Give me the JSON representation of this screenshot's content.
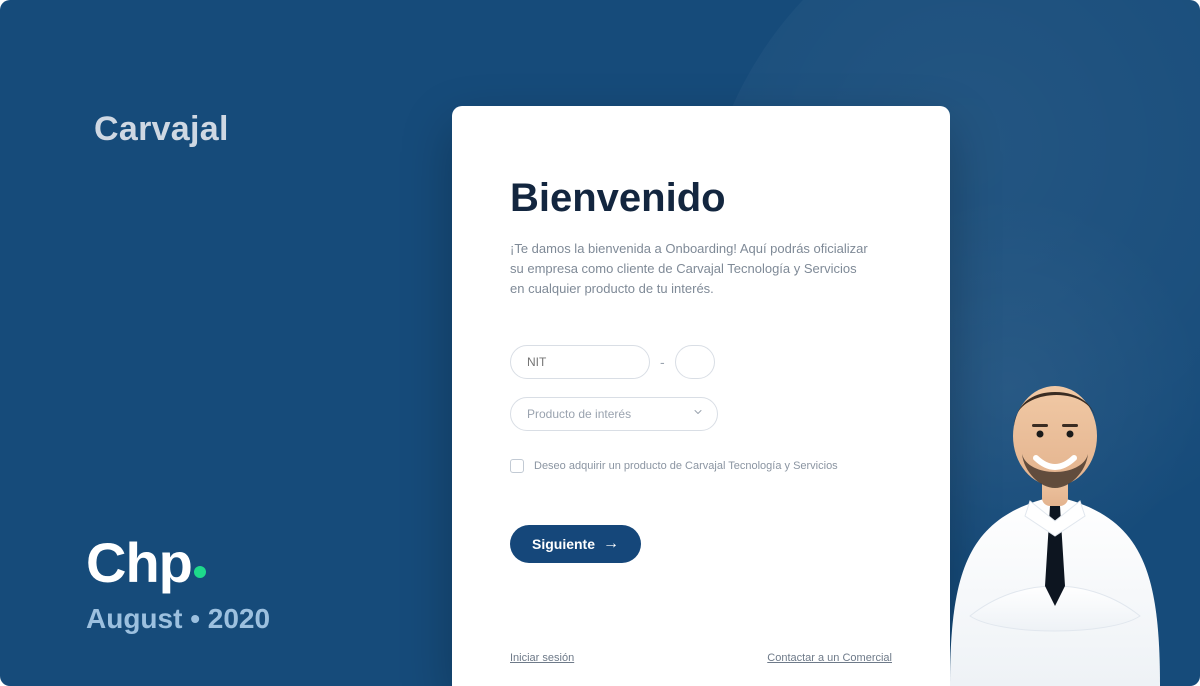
{
  "brand": "Carvajal",
  "chp": {
    "logo_text": "Chp",
    "date": "August • 2020"
  },
  "card": {
    "title": "Bienvenido",
    "lead": "¡Te damos la bienvenida a Onboarding! Aquí podrás oficializar su empresa como cliente de Carvajal Tecnología y Servicios en cualquier producto de tu interés.",
    "nit_placeholder": "NIT",
    "nit_suffix_placeholder": "",
    "product_placeholder": "Producto de interés",
    "checkbox_label": "Deseo adquirir un producto de Carvajal Tecnología y Servicios",
    "cta_label": "Siguiente",
    "footer_left": "Iniciar sesión",
    "footer_right": "Contactar a un Comercial"
  },
  "colors": {
    "bg": "#164b7a",
    "accent": "#1ed98b",
    "cta": "#15477a"
  }
}
